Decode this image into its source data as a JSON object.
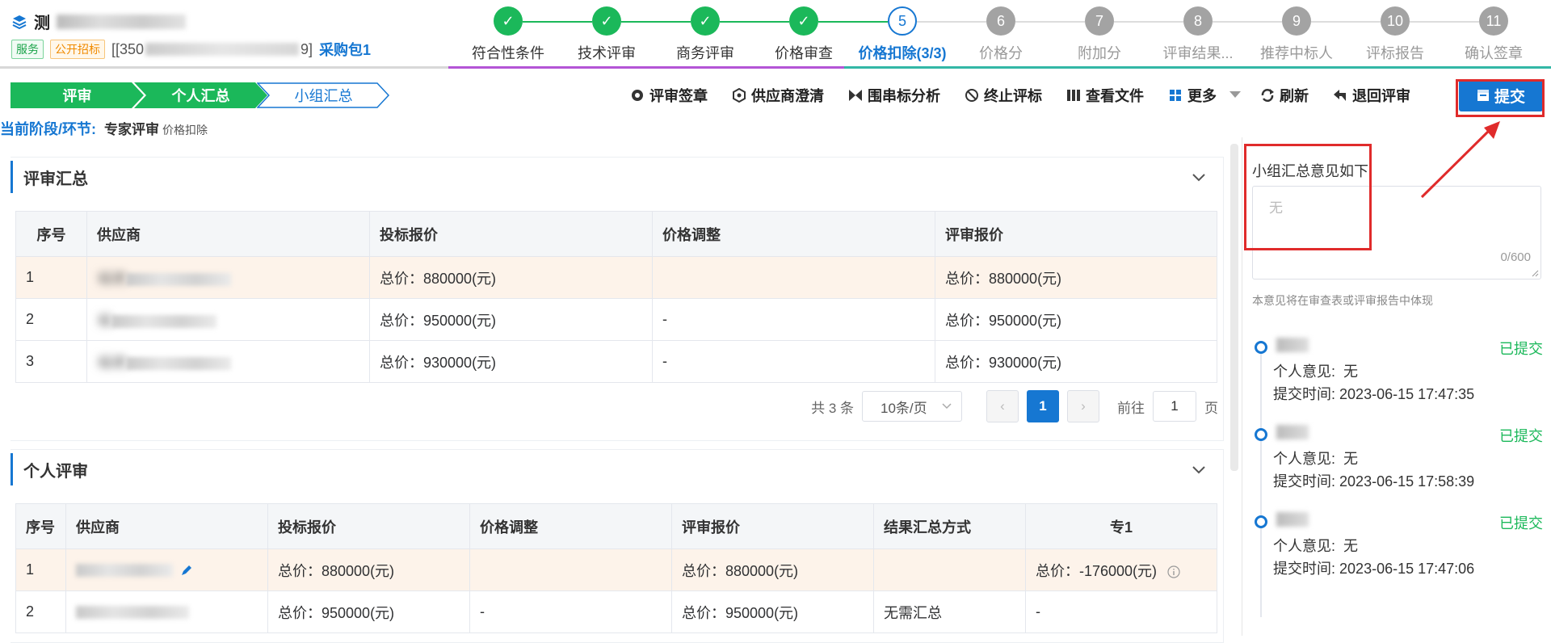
{
  "header": {
    "title_visible": "测",
    "tags": [
      "服务",
      "公开招标"
    ],
    "project_code_prefix": "[[350",
    "project_code_suffix": "9]",
    "package": "采购包1"
  },
  "steps": [
    {
      "num": "✓",
      "label": "符合性条件",
      "state": "done"
    },
    {
      "num": "✓",
      "label": "技术评审",
      "state": "done"
    },
    {
      "num": "✓",
      "label": "商务评审",
      "state": "done"
    },
    {
      "num": "✓",
      "label": "价格审查",
      "state": "done"
    },
    {
      "num": "5",
      "label": "价格扣除(3/3)",
      "state": "cur"
    },
    {
      "num": "6",
      "label": "价格分",
      "state": "todo"
    },
    {
      "num": "7",
      "label": "附加分",
      "state": "todo"
    },
    {
      "num": "8",
      "label": "评审结果...",
      "state": "todo"
    },
    {
      "num": "9",
      "label": "推荐中标人",
      "state": "todo"
    },
    {
      "num": "10",
      "label": "评标报告",
      "state": "todo"
    },
    {
      "num": "11",
      "label": "确认签章",
      "state": "todo"
    }
  ],
  "breadcrumb": [
    "评审",
    "个人汇总",
    "小组汇总"
  ],
  "actions": {
    "sign": "评审签章",
    "clarify": "供应商澄清",
    "bid_analysis": "围串标分析",
    "stop": "终止评标",
    "view_files": "查看文件",
    "more": "更多",
    "refresh": "刷新",
    "return": "退回评审",
    "submit": "提交"
  },
  "stage": {
    "label": "当前阶段/环节:",
    "value": "专家评审",
    "sub": "价格扣除"
  },
  "summary": {
    "title": "评审汇总",
    "columns": [
      "序号",
      "供应商",
      "投标报价",
      "价格调整",
      "评审报价"
    ],
    "rows": [
      {
        "no": "1",
        "supplier": "福建",
        "bid": "总价：880000(元)",
        "adj": "",
        "review": "总价：880000(元)"
      },
      {
        "no": "2",
        "supplier": "福",
        "bid": "总价：950000(元)",
        "adj": "-",
        "review": "总价：950000(元)"
      },
      {
        "no": "3",
        "supplier": "福建",
        "bid": "总价：930000(元)",
        "adj": "-",
        "review": "总价：930000(元)"
      }
    ],
    "pager": {
      "total": "共 3 条",
      "size": "10条/页",
      "page": "1",
      "goto_label": "前往",
      "goto_value": "1",
      "page_unit": "页"
    }
  },
  "personal": {
    "title": "个人评审",
    "columns": [
      "序号",
      "供应商",
      "投标报价",
      "价格调整",
      "评审报价",
      "结果汇总方式",
      "专1"
    ],
    "rows": [
      {
        "no": "1",
        "supplier": "",
        "bid": "总价：880000(元)",
        "adj": "",
        "review": "总价：880000(元)",
        "mode": "",
        "expert": "总价：-176000(元)"
      },
      {
        "no": "2",
        "supplier": "",
        "bid": "总价：950000(元)",
        "adj": "-",
        "review": "总价：950000(元)",
        "mode": "无需汇总",
        "expert": "-"
      }
    ]
  },
  "side": {
    "opinion_label": "小组汇总意见如下:",
    "placeholder": "无",
    "counter": "0/600",
    "hint": "本意见将在审查表或评审报告中体现",
    "entries": [
      {
        "status": "已提交",
        "opinion_label": "个人意见:",
        "opinion": "无",
        "time_label": "提交时间:",
        "time": "2023-06-15 17:47:35"
      },
      {
        "status": "已提交",
        "opinion_label": "个人意见:",
        "opinion": "无",
        "time_label": "提交时间:",
        "time": "2023-06-15 17:58:39"
      },
      {
        "status": "已提交",
        "opinion_label": "个人意见:",
        "opinion": "无",
        "time_label": "提交时间:",
        "time": "2023-06-15 17:47:06"
      }
    ]
  },
  "colors": {
    "primary": "#1677d2",
    "success": "#1bb85a",
    "highlight": "#e02b2b"
  }
}
